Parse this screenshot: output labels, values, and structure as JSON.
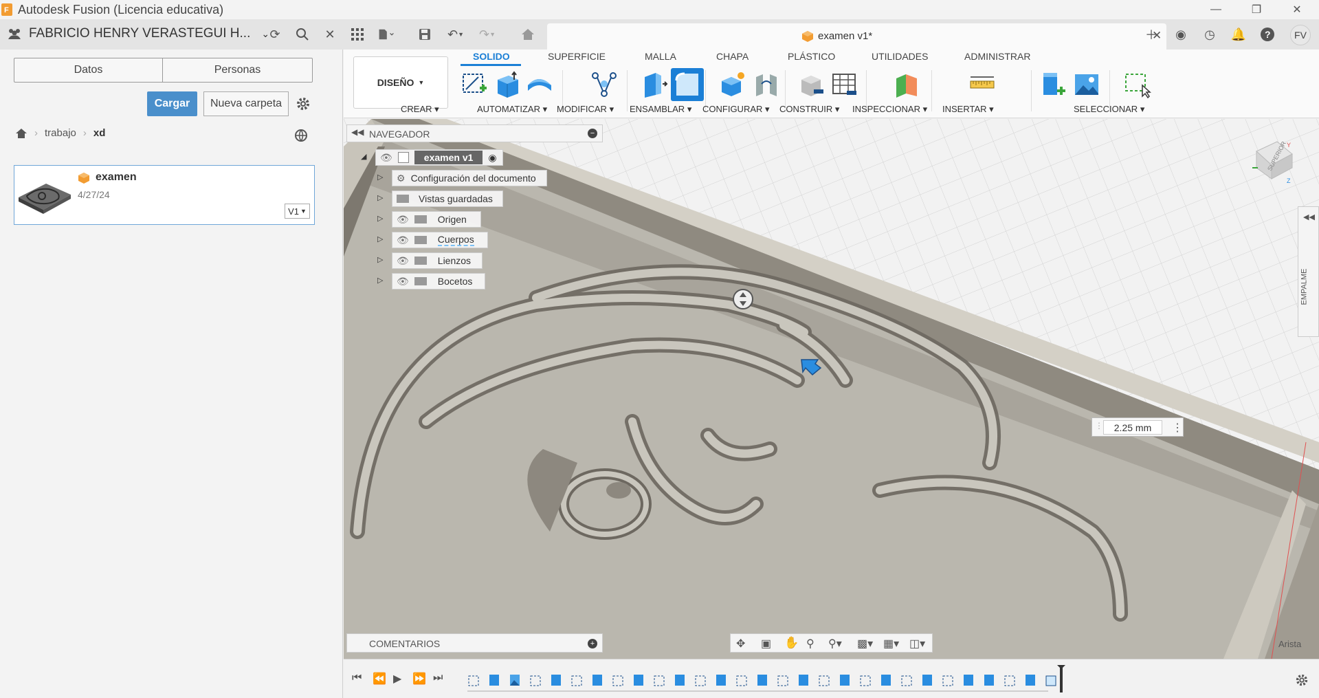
{
  "window": {
    "title": "Autodesk Fusion (Licencia educativa)"
  },
  "appbar": {
    "user_name": "FABRICIO HENRY VERASTEGUI H...",
    "document_tab": "examen v1*",
    "user_initials": "FV"
  },
  "data_panel": {
    "tabs": [
      "Datos",
      "Personas"
    ],
    "upload_label": "Cargar",
    "new_folder_label": "Nueva carpeta",
    "breadcrumb": [
      "trabajo",
      "xd"
    ],
    "file": {
      "name": "examen",
      "date": "4/27/24",
      "version": "V1"
    }
  },
  "toolbar": {
    "workspace": "DISEÑO",
    "tabs": [
      "SOLIDO",
      "SUPERFICIE",
      "MALLA",
      "CHAPA",
      "PLÁSTICO",
      "UTILIDADES",
      "ADMINISTRAR"
    ],
    "active_tab": "SOLIDO",
    "groups": [
      "CREAR",
      "AUTOMATIZAR",
      "MODIFICAR",
      "ENSAMBLAR",
      "CONFIGURAR",
      "CONSTRUIR",
      "INSPECCIONAR",
      "INSERTAR",
      "SELECCIONAR"
    ]
  },
  "browser": {
    "title": "NAVEGADOR",
    "root": "examen v1",
    "items": [
      "Configuración del documento",
      "Vistas guardadas",
      "Origen",
      "Cuerpos",
      "Lienzos",
      "Bocetos"
    ]
  },
  "comments_label": "COMENTARIOS",
  "dimension_value": "2.25 mm",
  "side_panel_label": "EMPALME",
  "viewcube_label": "SUPERIOR",
  "corner_label": "Arista",
  "colors": {
    "accent": "#1b7fd6",
    "primary_button": "#4a8fcb",
    "fusion_orange": "#f29c32",
    "model_surface": "#b9b6ae"
  }
}
